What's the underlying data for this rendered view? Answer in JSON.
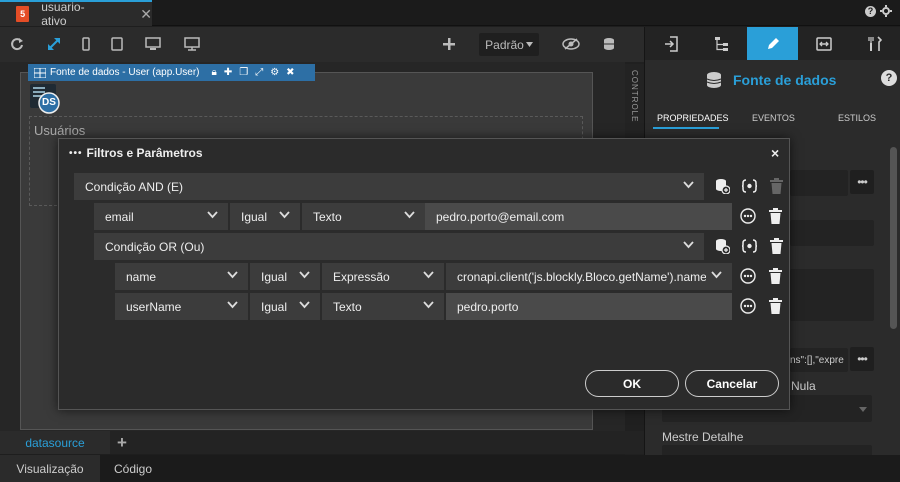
{
  "file_tab": {
    "icon_text": "5",
    "name": "usuario-ativo",
    "close": "✕"
  },
  "toolbar": {
    "mode_label": "Padrão"
  },
  "datasource_bar": {
    "label": "Fonte de dados - User (app.User)"
  },
  "ds_chip": {
    "label": "DS"
  },
  "canvas": {
    "usuarios_label": "Usuários",
    "vertical_label": "CONTROLE"
  },
  "right_panel": {
    "title": "Fonte de dados",
    "help": "?",
    "tabs": [
      "PROPRIEDADES",
      "EVENTOS",
      "ESTILOS"
    ],
    "filter_fragment": "ns\":[],\"expre",
    "nula_label": "Nula",
    "mestre_detalhe_label": "Mestre Detalhe"
  },
  "bottom": {
    "datasource_tab": "datasource",
    "add": "+",
    "view_tabs": [
      "Visualização",
      "Código"
    ]
  },
  "modal": {
    "title": "Filtros e Parâmetros",
    "close": "×",
    "and_condition": "Condição AND (E)",
    "rows": [
      {
        "field": "email",
        "operator": "Igual",
        "type": "Texto",
        "value": "pedro.porto@email.com"
      },
      {
        "field": "name",
        "operator": "Igual",
        "type": "Expressão",
        "value": "cronapi.client('js.blockly.Bloco.getName').name"
      },
      {
        "field": "userName",
        "operator": "Igual",
        "type": "Texto",
        "value": "pedro.porto"
      }
    ],
    "or_condition": "Condição OR (Ou)",
    "ok_label": "OK",
    "cancel_label": "Cancelar"
  },
  "colors": {
    "accent": "#2a9fd8",
    "datasource_bar": "#2d6fa5"
  }
}
